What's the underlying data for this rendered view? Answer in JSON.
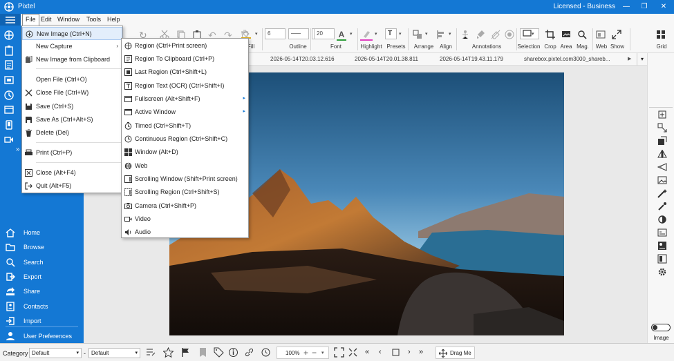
{
  "app": {
    "title": "Pixtel",
    "license": "Licensed - Business",
    "window_controls": [
      "—",
      "❐",
      "✕"
    ]
  },
  "menubar": [
    "File",
    "Edit",
    "Window",
    "Tools",
    "Help"
  ],
  "toolbar": {
    "labels": [
      "Fill",
      "Outline",
      "Font",
      "Highlight",
      "Presets",
      "Arrange",
      "Align",
      "Annotations",
      "Selection",
      "Crop",
      "Area",
      "Mag.",
      "Web",
      "Show",
      "Grid"
    ],
    "outline_width": "6",
    "font_size": "20",
    "font_color": "#2e9e3a",
    "highlight_color": "#e040c0"
  },
  "tabs": [
    "2026-05-14T20.03.12.616",
    "2026-05-14T20.01.38.811",
    "2026-05-14T19.43.11.179",
    "sharebox.pixtel.com3000_shareb..."
  ],
  "file_menu": [
    {
      "label": "New Image (Ctrl+N)",
      "icon": "new-image-icon",
      "submenu": false
    },
    {
      "label": "New Capture",
      "icon": "",
      "submenu": true
    },
    {
      "label": "New Image from Clipboard",
      "icon": "clipboard-icon",
      "submenu": false
    },
    {
      "label": "Open File (Ctrl+O)",
      "icon": "",
      "submenu": false
    },
    {
      "label": "Close File (Ctrl+W)",
      "icon": "close-x-icon",
      "submenu": false
    },
    {
      "label": "Save (Ctrl+S)",
      "icon": "save-icon",
      "submenu": false
    },
    {
      "label": "Save As (Ctrl+Alt+S)",
      "icon": "save-as-icon",
      "submenu": false
    },
    {
      "label": "Delete (Del)",
      "icon": "trash-icon",
      "submenu": false
    },
    {
      "label": "Print (Ctrl+P)",
      "icon": "print-icon",
      "submenu": false
    },
    {
      "label": "Close (Alt+F4)",
      "icon": "close-window-icon",
      "submenu": false
    },
    {
      "label": "Quit (Alt+F5)",
      "icon": "quit-icon",
      "submenu": false
    }
  ],
  "capture_submenu": [
    {
      "label": "Region (Ctrl+Print screen)",
      "icon": "region-icon"
    },
    {
      "label": "Region To Clipboard (Ctrl+P)",
      "icon": "region-clipboard-icon"
    },
    {
      "label": "Last Region (Ctrl+Shift+L)",
      "icon": "last-region-icon"
    },
    {
      "label": "Region Text (OCR) (Ctrl+Shift+I)",
      "icon": "ocr-icon"
    },
    {
      "label": "Fullscreen (Alt+Shift+F)",
      "icon": "fullscreen-icon",
      "submenu": true
    },
    {
      "label": "Active Window",
      "icon": "active-window-icon",
      "submenu": true
    },
    {
      "label": "Timed (Ctrl+Shift+T)",
      "icon": "timer-icon"
    },
    {
      "label": "Continuous Region (Ctrl+Shift+C)",
      "icon": "continuous-region-icon"
    },
    {
      "label": "Window (Alt+D)",
      "icon": "windows-icon"
    },
    {
      "label": "Web",
      "icon": "globe-icon"
    },
    {
      "label": "Scrolling Window (Shift+Print screen)",
      "icon": "scrolling-window-icon"
    },
    {
      "label": "Scrolling Region (Ctrl+Shift+S)",
      "icon": "scrolling-region-icon"
    },
    {
      "label": "Camera (Ctrl+Shift+P)",
      "icon": "camera-icon"
    },
    {
      "label": "Video",
      "icon": "video-icon"
    },
    {
      "label": "Audio",
      "icon": "audio-icon"
    }
  ],
  "sidebar": {
    "items": [
      {
        "label": "Home",
        "icon": "home-icon"
      },
      {
        "label": "Browse",
        "icon": "folder-icon"
      },
      {
        "label": "Search",
        "icon": "search-icon"
      },
      {
        "label": "Export",
        "icon": "export-icon"
      },
      {
        "label": "Share",
        "icon": "share-icon"
      },
      {
        "label": "Contacts",
        "icon": "contacts-icon"
      },
      {
        "label": "Import",
        "icon": "import-icon"
      },
      {
        "label": "User Preferences",
        "icon": "user-icon"
      }
    ]
  },
  "right_panel": {
    "label": "Image"
  },
  "statusbar": {
    "category_label": "Category",
    "category_value": "Default",
    "dash": "-",
    "second_value": "Default",
    "zoom": "100%",
    "drag_label": "Drag Me"
  },
  "colors": {
    "accent": "#1478d4",
    "menu_highlight": "#e3eefb"
  }
}
